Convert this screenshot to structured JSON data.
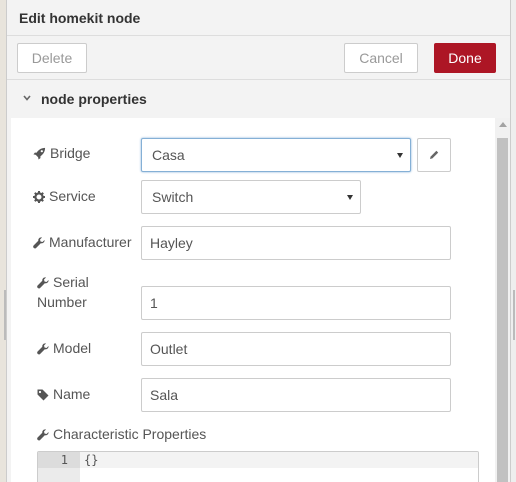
{
  "dialog": {
    "title": "Edit homekit node"
  },
  "toolbar": {
    "delete_label": "Delete",
    "cancel_label": "Cancel",
    "done_label": "Done"
  },
  "section": {
    "label": "node properties"
  },
  "form": {
    "bridge": {
      "label": "Bridge",
      "value": "Casa",
      "icon": "rocket-icon"
    },
    "service": {
      "label": "Service",
      "value": "Switch",
      "icon": "gear-icon"
    },
    "manufacturer": {
      "label": "Manufacturer",
      "value": "Hayley",
      "icon": "wrench-icon"
    },
    "serial_number": {
      "label_line1": "Serial",
      "label_line2": "Number",
      "value": "1",
      "icon": "wrench-icon"
    },
    "model": {
      "label": "Model",
      "value": "Outlet",
      "icon": "wrench-icon"
    },
    "name": {
      "label": "Name",
      "value": "Sala",
      "icon": "tag-icon"
    },
    "characteristic_properties": {
      "label": "Characteristic Properties",
      "icon": "wrench-icon",
      "line_number": "1",
      "code": "{}"
    }
  },
  "colors": {
    "done_button": "#ad1625",
    "focus_border": "#85b0d6"
  }
}
